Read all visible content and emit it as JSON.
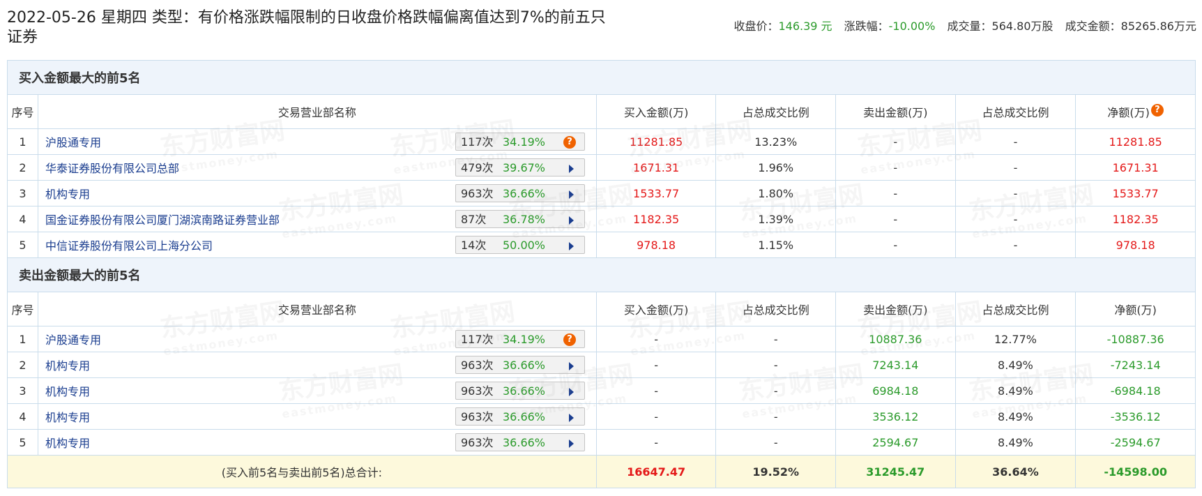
{
  "header": {
    "title": "2022-05-26 星期四 类型：有价格涨跌幅限制的日收盘价格跌幅偏离值达到7%的前五只证券",
    "close_label": "收盘价：",
    "close_value": "146.39 元",
    "change_label": "涨跌幅：",
    "change_value": "-10.00%",
    "volume_label": "成交量：",
    "volume_value": "564.80万股",
    "amount_label": "成交金额：",
    "amount_value": "85265.86万元"
  },
  "columns": [
    "序号",
    "交易营业部名称",
    "买入金额(万)",
    "占总成交比例",
    "卖出金额(万)",
    "占总成交比例",
    "净额(万)"
  ],
  "buy_section": {
    "title": "买入金额最大的前5名",
    "rows": [
      {
        "rank": "1",
        "name": "沪股通专用",
        "count": "117次",
        "pct": "34.19%",
        "icon": "question",
        "buy": "11281.85",
        "buy_ratio": "13.23%",
        "sell": "-",
        "sell_ratio": "-",
        "net": "11281.85"
      },
      {
        "rank": "2",
        "name": "华泰证券股份有限公司总部",
        "count": "479次",
        "pct": "39.67%",
        "icon": "arrow",
        "buy": "1671.31",
        "buy_ratio": "1.96%",
        "sell": "-",
        "sell_ratio": "-",
        "net": "1671.31"
      },
      {
        "rank": "3",
        "name": "机构专用",
        "count": "963次",
        "pct": "36.66%",
        "icon": "arrow",
        "buy": "1533.77",
        "buy_ratio": "1.80%",
        "sell": "-",
        "sell_ratio": "-",
        "net": "1533.77"
      },
      {
        "rank": "4",
        "name": "国金证券股份有限公司厦门湖滨南路证券营业部",
        "count": "87次",
        "pct": "36.78%",
        "icon": "arrow",
        "buy": "1182.35",
        "buy_ratio": "1.39%",
        "sell": "-",
        "sell_ratio": "-",
        "net": "1182.35"
      },
      {
        "rank": "5",
        "name": "中信证券股份有限公司上海分公司",
        "count": "14次",
        "pct": "50.00%",
        "icon": "arrow",
        "buy": "978.18",
        "buy_ratio": "1.15%",
        "sell": "-",
        "sell_ratio": "-",
        "net": "978.18"
      }
    ]
  },
  "sell_section": {
    "title": "卖出金额最大的前5名",
    "rows": [
      {
        "rank": "1",
        "name": "沪股通专用",
        "count": "117次",
        "pct": "34.19%",
        "icon": "question",
        "buy": "-",
        "buy_ratio": "-",
        "sell": "10887.36",
        "sell_ratio": "12.77%",
        "net": "-10887.36"
      },
      {
        "rank": "2",
        "name": "机构专用",
        "count": "963次",
        "pct": "36.66%",
        "icon": "arrow",
        "buy": "-",
        "buy_ratio": "-",
        "sell": "7243.14",
        "sell_ratio": "8.49%",
        "net": "-7243.14"
      },
      {
        "rank": "3",
        "name": "机构专用",
        "count": "963次",
        "pct": "36.66%",
        "icon": "arrow",
        "buy": "-",
        "buy_ratio": "-",
        "sell": "6984.18",
        "sell_ratio": "8.49%",
        "net": "-6984.18"
      },
      {
        "rank": "4",
        "name": "机构专用",
        "count": "963次",
        "pct": "36.66%",
        "icon": "arrow",
        "buy": "-",
        "buy_ratio": "-",
        "sell": "3536.12",
        "sell_ratio": "8.49%",
        "net": "-3536.12"
      },
      {
        "rank": "5",
        "name": "机构专用",
        "count": "963次",
        "pct": "36.66%",
        "icon": "arrow",
        "buy": "-",
        "buy_ratio": "-",
        "sell": "2594.67",
        "sell_ratio": "8.49%",
        "net": "-2594.67"
      }
    ]
  },
  "total": {
    "label": "(买入前5名与卖出前5名)总合计:",
    "buy": "16647.47",
    "buy_ratio": "19.52%",
    "sell": "31245.47",
    "sell_ratio": "36.64%",
    "net": "-14598.00"
  },
  "watermark": {
    "cn": "东方财富网",
    "en": "eastmoney.com"
  },
  "colors": {
    "buy": "#e41818",
    "sell": "#2a9a2a",
    "link": "#1a3d8f",
    "section_bg": "#eef4fb",
    "total_bg": "#fdf9dc"
  }
}
